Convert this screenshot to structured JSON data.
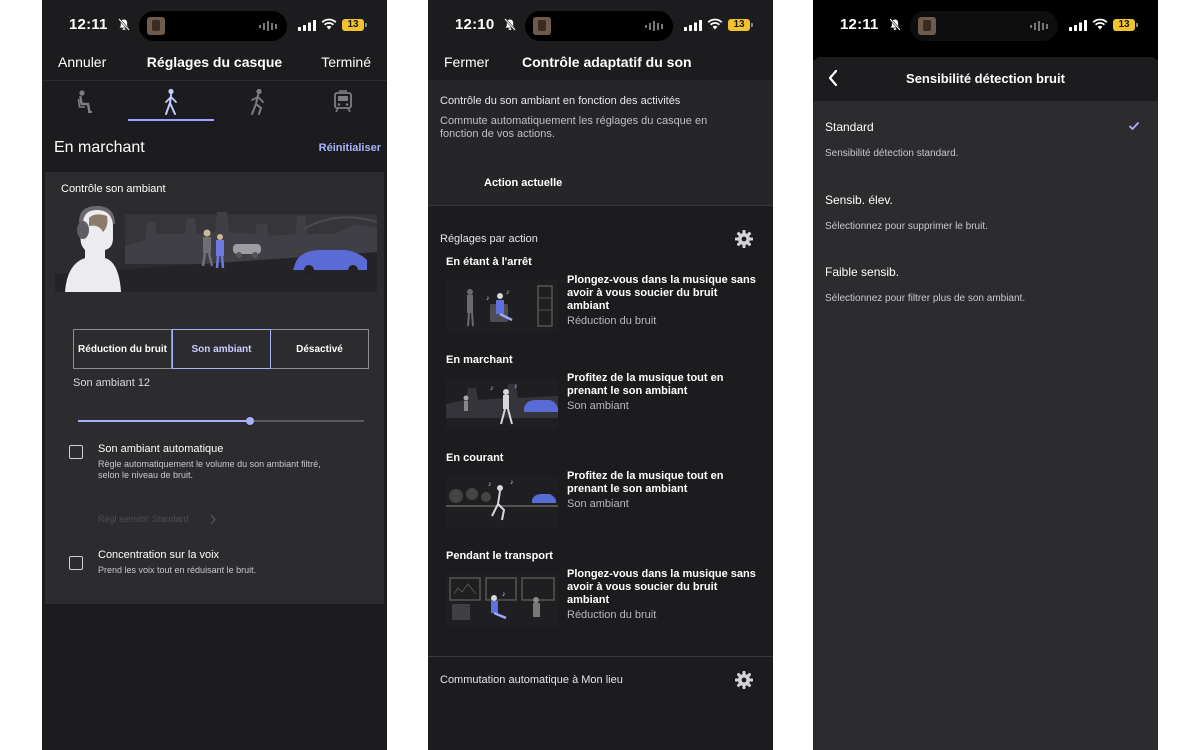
{
  "status_bars": [
    {
      "time": "12:11",
      "battery": "13"
    },
    {
      "time": "12:10",
      "battery": "13"
    },
    {
      "time": "12:11",
      "battery": "13"
    }
  ],
  "headset_settings": {
    "nav": {
      "left": "Annuler",
      "title": "Réglages du casque",
      "right": "Terminé"
    },
    "tabs": [
      {
        "icon": "sitting-icon"
      },
      {
        "icon": "walking-icon",
        "active": true
      },
      {
        "icon": "running-icon"
      },
      {
        "icon": "train-icon"
      }
    ],
    "section_title": "En marchant",
    "reset_label": "Réinitialiser",
    "card_title": "Contrôle son ambiant",
    "segments": [
      "Réduction du bruit",
      "Son ambiant",
      "Désactivé"
    ],
    "selected_segment": 1,
    "level_label": "Son ambiant 12",
    "slider": {
      "value": 12,
      "max": 20
    },
    "auto_ambient": {
      "title": "Son ambiant automatique",
      "desc_line1": "Règle automatiquement le volume du son ambiant filtré,",
      "desc_line2": "selon le niveau de bruit.",
      "sub_link": "Régl sensibl: Standard"
    },
    "voice_focus": {
      "title": "Concentration sur la voix",
      "desc": "Prend les voix tout en réduisant le bruit."
    },
    "accent_color": "#a9b1ff"
  },
  "adaptive_control": {
    "nav": {
      "left": "Fermer",
      "title": "Contrôle adaptatif du son"
    },
    "intro_title": "Contrôle du son ambiant en fonction des activités",
    "intro_desc": "Commute automatiquement les réglages du casque en fonction de vos actions.",
    "current_action_label": "Action actuelle",
    "per_action_title": "Réglages par action",
    "actions": [
      {
        "name": "En étant à l'arrêt",
        "desc": "Plongez-vous dans la musique sans avoir à vous soucier du bruit ambiant",
        "mode": "Réduction du bruit"
      },
      {
        "name": "En marchant",
        "desc": "Profitez de la musique tout en prenant le son ambiant",
        "mode": "Son ambiant"
      },
      {
        "name": "En courant",
        "desc": "Profitez de la musique tout en prenant le son ambiant",
        "mode": "Son ambiant"
      },
      {
        "name": "Pendant le transport",
        "desc": "Plongez-vous dans la musique sans avoir à vous soucier du bruit ambiant",
        "mode": "Réduction du bruit"
      }
    ],
    "auto_location_label": "Commutation automatique à Mon lieu"
  },
  "sensitivity": {
    "title": "Sensibilité détection bruit",
    "options": [
      {
        "label": "Standard",
        "desc": "Sensibilité détection standard.",
        "selected": true
      },
      {
        "label": "Sensib. élev.",
        "desc": "Sélectionnez pour supprimer le bruit."
      },
      {
        "label": "Faible sensib.",
        "desc": "Sélectionnez pour filtrer plus de son ambiant."
      }
    ]
  }
}
